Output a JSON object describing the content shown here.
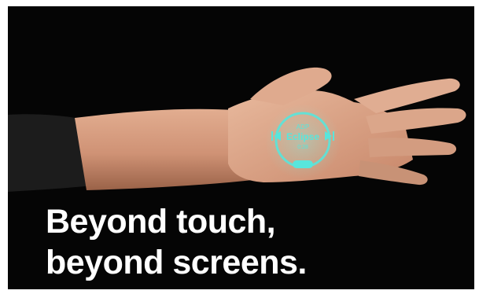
{
  "headline": {
    "line1": "Beyond touch,",
    "line2": "beyond screens."
  },
  "projection": {
    "artist": "ADP",
    "title": "Eclipse",
    "time": "0:28",
    "prev_icon": "skip-back-icon",
    "next_icon": "skip-forward-icon",
    "color": "#58e6dc"
  },
  "colors": {
    "background": "#050505",
    "headline": "#ffffff",
    "skin": "#d9a083",
    "sleeve": "#1c1c1c"
  }
}
